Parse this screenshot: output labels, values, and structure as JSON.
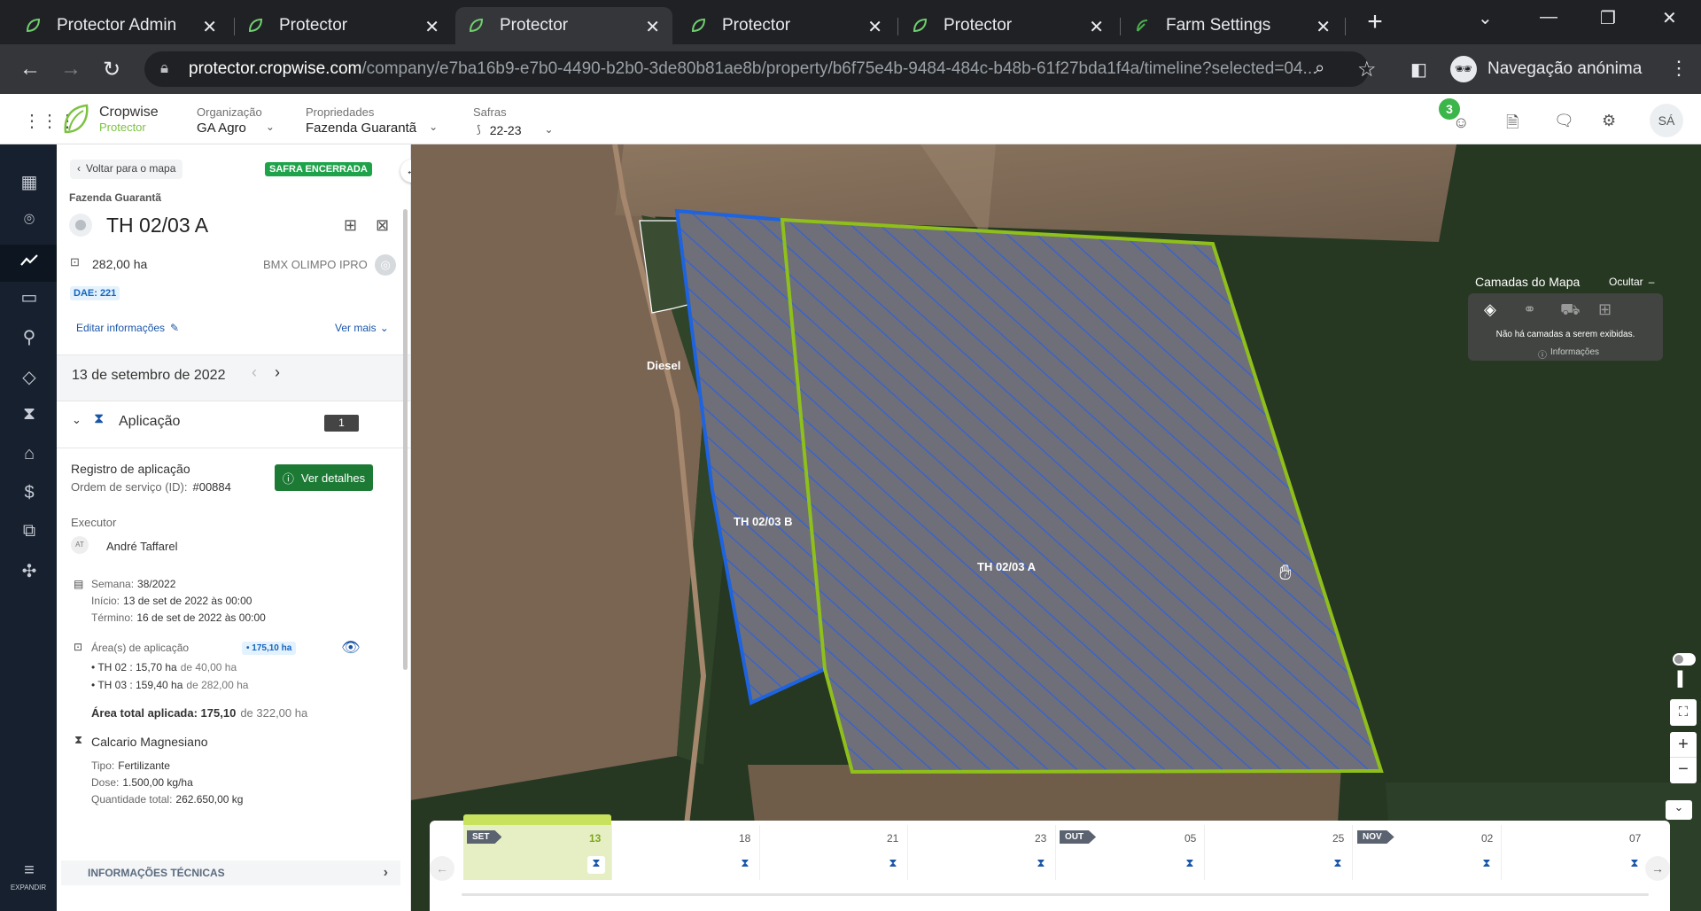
{
  "browser": {
    "tabs": [
      {
        "title": "Protector Admin",
        "active": false
      },
      {
        "title": "Protector",
        "active": false
      },
      {
        "title": "Protector",
        "active": true
      },
      {
        "title": "Protector",
        "active": false
      },
      {
        "title": "Protector",
        "active": false
      },
      {
        "title": "Farm Settings",
        "active": false
      }
    ],
    "url_host": "protector.cropwise.com",
    "url_path": "/company/e7ba16b9-e7b0-4490-b2b0-3de80b81ae8b/property/b6f75e4b-9484-484c-b48b-61f27bda1f4a/timeline?selected=04...",
    "incognito_label": "Navegação anónima"
  },
  "header": {
    "logo_name": "Cropwise",
    "logo_sub": "Protector",
    "org_label": "Organização",
    "org_value": "GA Agro",
    "prop_label": "Propriedades",
    "prop_value": "Fazenda Guarantã",
    "season_label": "Safras",
    "season_value": "22-23",
    "notif_count": "3",
    "avatar": "SÁ"
  },
  "sidebar": {
    "expand_label": "EXPANDIR"
  },
  "panel": {
    "back_label": "Voltar para o mapa",
    "status_badge": "SAFRA ENCERRADA",
    "farm_name": "Fazenda Guarantã",
    "field_name": "TH 02/03 A",
    "area": "282,00 ha",
    "variety": "BMX OLIMPO IPRO",
    "dae": "DAE: 221",
    "edit_label": "Editar informações",
    "see_more": "Ver mais",
    "date": "13 de setembro de 2022",
    "section_title": "Aplicação",
    "section_count": "1",
    "record_title": "Registro de aplicação",
    "order_label": "Ordem de serviço (ID):",
    "order_id": "#00884",
    "details_button": "Ver detalhes",
    "executor_label": "Executor",
    "executor_initials": "AT",
    "executor_name": "André Taffarel",
    "week_label": "Semana:",
    "week_value": "38/2022",
    "start_label": "Início:",
    "start_value": "13 de set de 2022 às 00:00",
    "end_label": "Término:",
    "end_value": "16 de set de 2022 às 00:00",
    "areas_label": "Área(s) de aplicação",
    "areas_badge": "• 175,10 ha",
    "area_rows": [
      {
        "name": "• TH 02 : 15,70 ha",
        "of": "de 40,00 ha"
      },
      {
        "name": "• TH 03 : 159,40 ha",
        "of": "de 282,00 ha"
      }
    ],
    "total_label": "Área total aplicada: 175,10",
    "total_of": "de 322,00 ha",
    "product_name": "Calcario Magnesiano",
    "type_label": "Tipo:",
    "type_value": "Fertilizante",
    "dose_label": "Dose:",
    "dose_value": "1.500,00 kg/ha",
    "qty_label": "Quantidade total:",
    "qty_value": "262.650,00 kg",
    "tech_info": "INFORMAÇÕES TÉCNICAS"
  },
  "map": {
    "layers_title": "Camadas do Mapa",
    "hide_label": "Ocultar",
    "no_layers": "Não há camadas a serem exibidas.",
    "info_label": "Informações",
    "label_diesel": "Diesel",
    "label_b": "TH 02/03 B",
    "label_a": "TH 02/03 A",
    "colors": {
      "field_a_border": "#8fbf1a",
      "field_b_border": "#1e63e0",
      "hatch": "#2f5fe0"
    }
  },
  "timeline": {
    "months": [
      {
        "label": "SET"
      },
      {
        "label": "OUT"
      },
      {
        "label": "NOV"
      }
    ],
    "days": [
      "13",
      "18",
      "21",
      "23",
      "05",
      "25",
      "02",
      "07"
    ]
  }
}
